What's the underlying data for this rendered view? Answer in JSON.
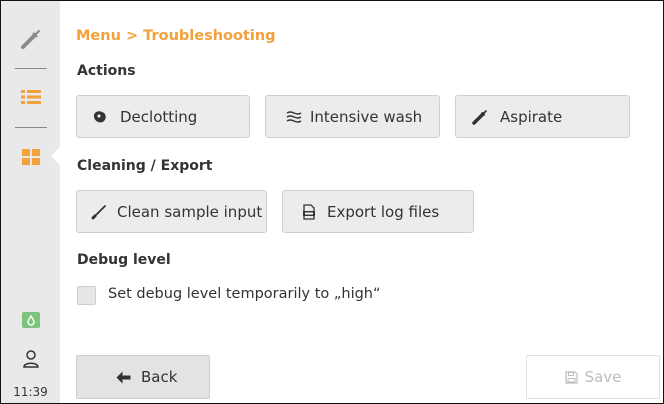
{
  "sidebar": {
    "icons": [
      "pipette-icon",
      "list-icon",
      "grid-icon",
      "drop-icon",
      "user-icon"
    ],
    "clock": "11:39"
  },
  "breadcrumb": "Menu > Troubleshooting",
  "sections": {
    "actions": "Actions",
    "cleaning": "Cleaning / Export",
    "debug": "Debug level"
  },
  "actions": {
    "declotting": "Declotting",
    "intensive_wash": "Intensive wash",
    "aspirate": "Aspirate"
  },
  "cleaning": {
    "clean_sample_input": "Clean sample input",
    "export_log_files": "Export log files"
  },
  "debug": {
    "checkbox_label": "Set debug level temporarily to „high“",
    "checked": false
  },
  "footer": {
    "back": "Back",
    "save": "Save"
  },
  "colors": {
    "accent": "#f3a13a",
    "sidebar_bg": "#e9e9e9",
    "button_bg": "#ececec",
    "status_green": "#7cc47d"
  }
}
